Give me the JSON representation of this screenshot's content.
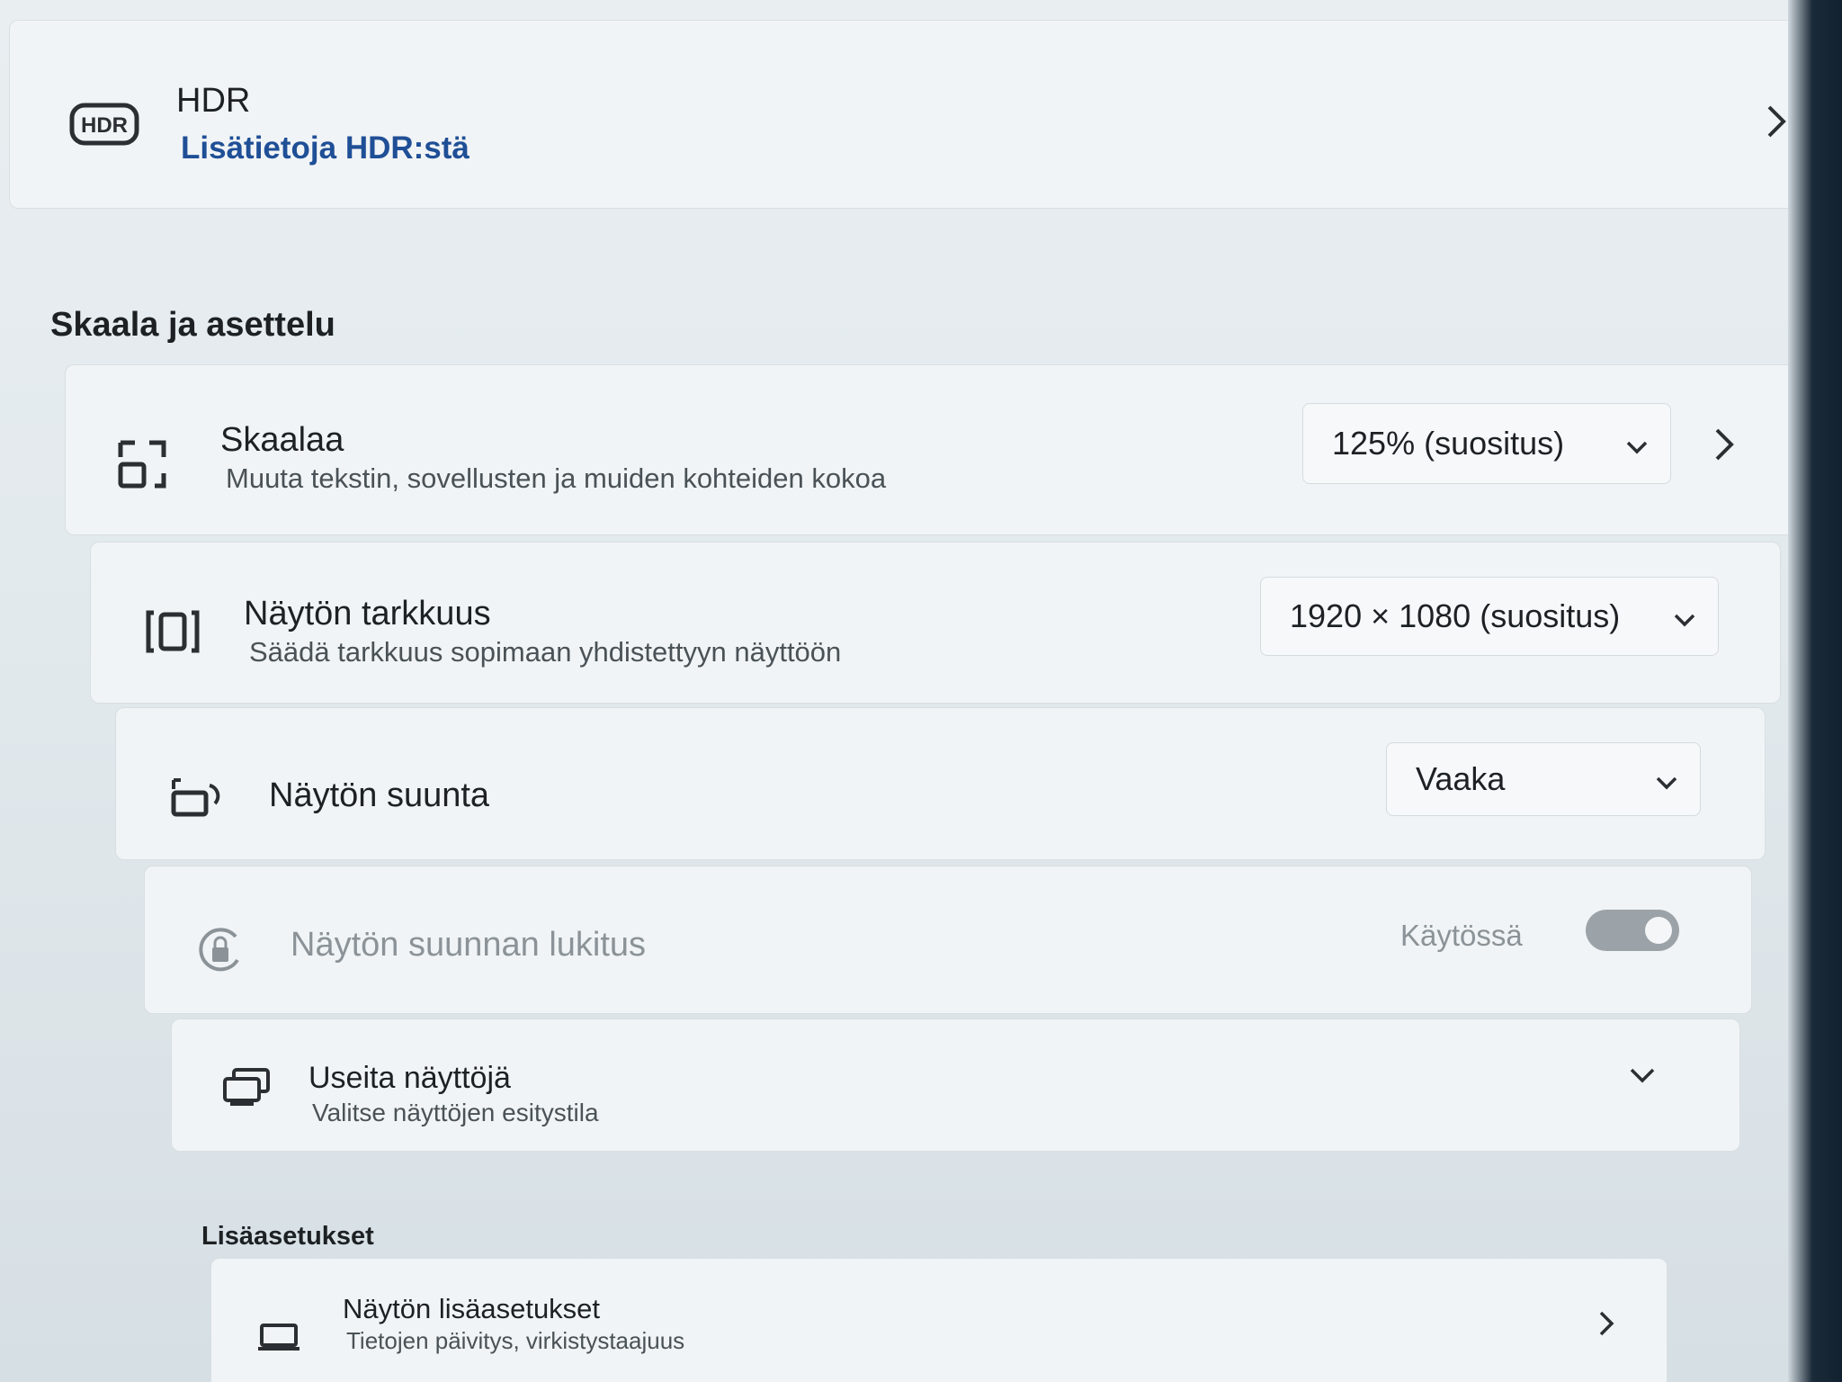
{
  "hdr": {
    "title": "HDR",
    "link": "Lisätietoja HDR:stä",
    "badge": "HDR"
  },
  "scale_layout": {
    "heading": "Skaala ja asettelu",
    "scale": {
      "title": "Skaalaa",
      "subtitle": "Muuta tekstin, sovellusten ja muiden kohteiden kokoa",
      "value": "125% (suositus)"
    },
    "resolution": {
      "title": "Näytön tarkkuus",
      "subtitle": "Säädä tarkkuus sopimaan yhdistettyyn näyttöön",
      "value": "1920 × 1080 (suositus)"
    },
    "orientation": {
      "title": "Näytön suunta",
      "value": "Vaaka"
    },
    "rotation_lock": {
      "title": "Näytön suunnan lukitus",
      "state_label": "Käytössä",
      "enabled": true,
      "disabled": true
    },
    "multiple_displays": {
      "title": "Useita näyttöjä",
      "subtitle": "Valitse näyttöjen esitystila"
    }
  },
  "more_settings": {
    "heading": "Lisäasetukset",
    "advanced_display": {
      "title": "Näytön lisäasetukset",
      "subtitle": "Tietojen päivitys, virkistystaajuus"
    }
  },
  "colors": {
    "link": "#1f4f96",
    "toggle_off_disabled": "#9ca3a8"
  }
}
